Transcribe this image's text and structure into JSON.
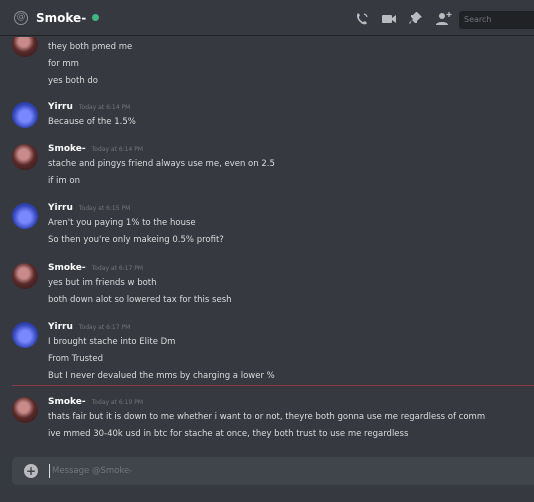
{
  "header": {
    "at_symbol": "@",
    "channel_name": "Smoke-",
    "search_placeholder": "Search"
  },
  "messages": [
    {
      "author": "",
      "timestamp": "",
      "lines": [
        "they both pmed me",
        "for mm",
        "yes both do"
      ]
    },
    {
      "author": "Yirru",
      "timestamp": "Today at 6:14 PM",
      "lines": [
        "Because of the 1.5%"
      ]
    },
    {
      "author": "Smoke-",
      "timestamp": "Today at 6:14 PM",
      "lines": [
        "stache and pingys friend always use me, even on 2.5",
        "if im on"
      ]
    },
    {
      "author": "Yirru",
      "timestamp": "Today at 6:15 PM",
      "lines": [
        "Aren't you paying 1% to the house",
        "So then you're only makeing 0.5% profit?"
      ]
    },
    {
      "author": "Smoke-",
      "timestamp": "Today at 6:17 PM",
      "lines": [
        "yes but im friends w both",
        "both down alot so lowered tax for this sesh"
      ]
    },
    {
      "author": "Yirru",
      "timestamp": "Today at 6:17 PM",
      "lines": [
        "I brought stache into Elite Dm",
        "From Trusted",
        "But I never devalued the mms by charging a lower %"
      ]
    },
    {
      "author": "Smoke-",
      "timestamp": "Today at 6:19 PM",
      "lines": [
        "thats fair but it is down to me whether i want to or not, theyre both gonna use me regardless of comm",
        "ive mmed 30-40k usd in btc for stache at once, they both trust to use me regardless"
      ]
    }
  ],
  "composer": {
    "placeholder": "Message @Smoke-",
    "plus_symbol": "+"
  },
  "colors": {
    "online": "#43b581",
    "divider": "#8a3a3f"
  }
}
